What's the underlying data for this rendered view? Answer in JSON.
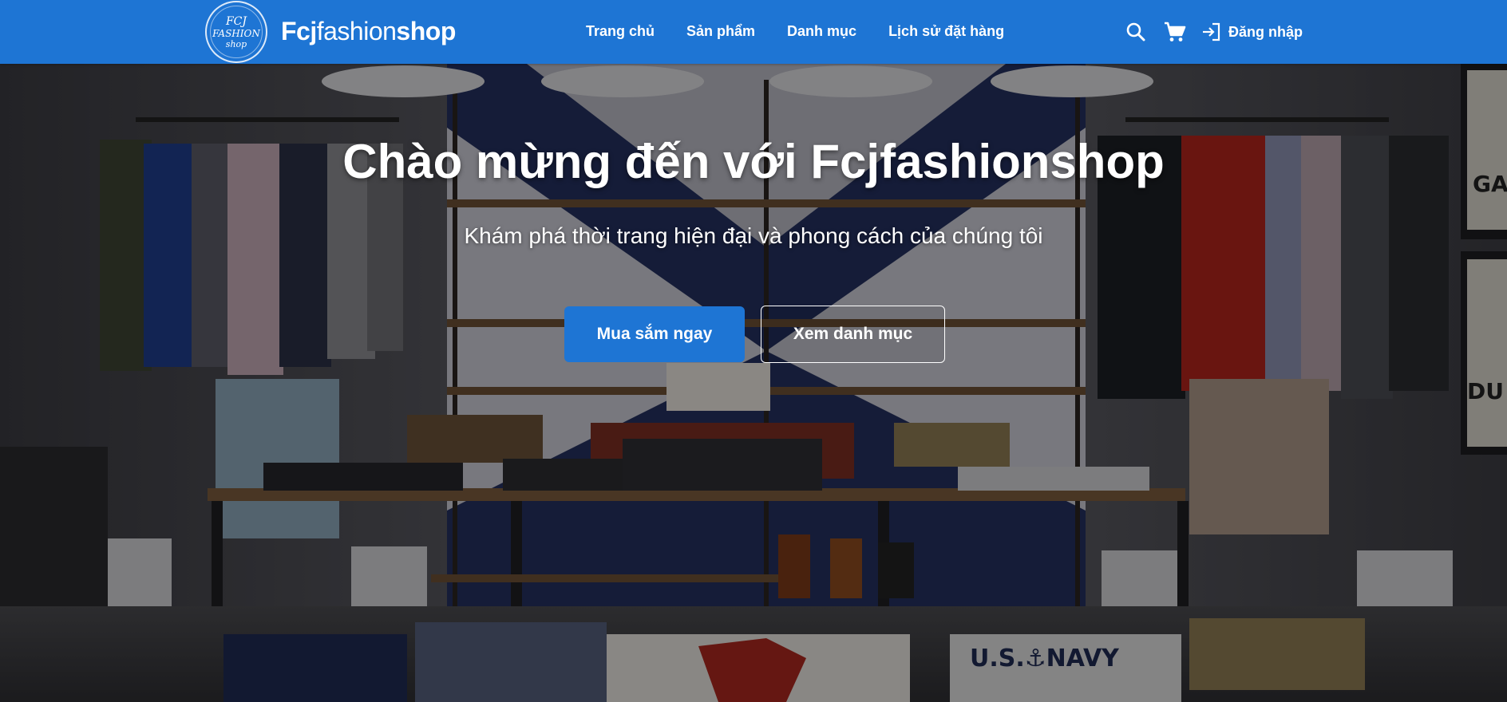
{
  "header": {
    "logo": {
      "line1": "FCJ",
      "line2": "FASHION",
      "line3": "shop"
    },
    "brand": {
      "part1": "Fcj",
      "part2": "fashion",
      "part3": "shop"
    },
    "nav": [
      {
        "label": "Trang chủ"
      },
      {
        "label": "Sản phẩm"
      },
      {
        "label": "Danh mục"
      },
      {
        "label": "Lịch sử đặt hàng"
      }
    ],
    "icons": {
      "search": "search-icon",
      "cart": "cart-icon",
      "login": "login-icon"
    },
    "login_label": "Đăng nhập"
  },
  "hero": {
    "title": "Chào mừng đến với Fcjfashionshop",
    "subtitle": "Khám phá thời trang hiện đại và phong cách của chúng tôi",
    "primary_button": "Mua sắm ngay",
    "secondary_button": "Xem danh mục",
    "background_props": {
      "navy_tag": "U.S.⚓NAVY",
      "right_wall_text_1": "GA",
      "right_wall_text_2": "DU"
    }
  },
  "colors": {
    "nav_bg": "#1e75d4",
    "primary_button": "#1e75d4",
    "text": "#ffffff"
  }
}
